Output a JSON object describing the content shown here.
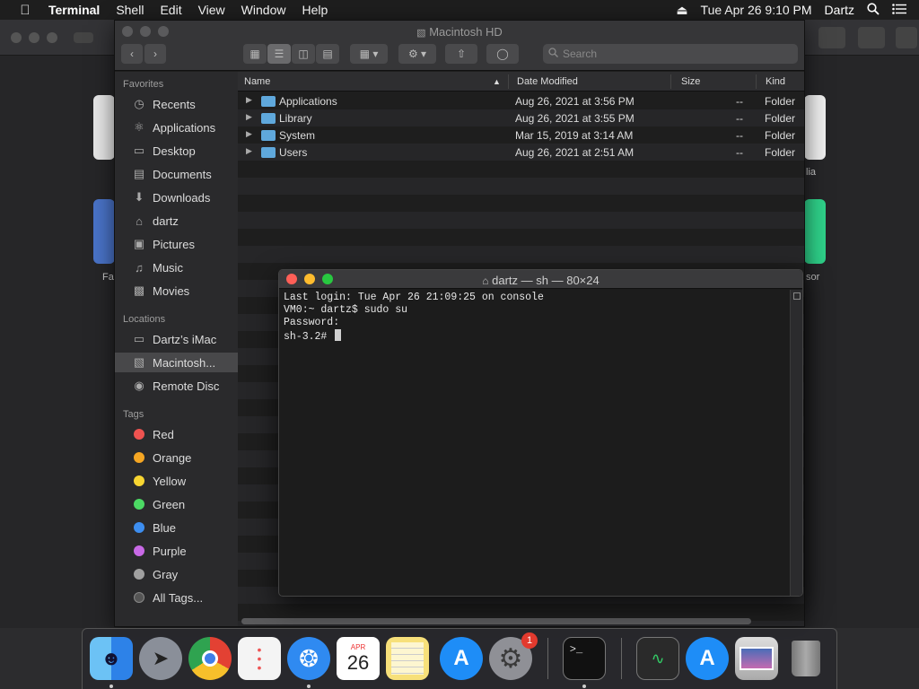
{
  "menubar": {
    "app": "Terminal",
    "items": [
      "Shell",
      "Edit",
      "View",
      "Window",
      "Help"
    ],
    "clock": "Tue Apr 26  9:10 PM",
    "user": "Dartz"
  },
  "background_window": {
    "labels": [
      "lia",
      "Fa",
      "sor"
    ]
  },
  "finder": {
    "title": "Macintosh HD",
    "search_placeholder": "Search",
    "sidebar": {
      "favorites_label": "Favorites",
      "favorites": [
        {
          "label": "Recents",
          "icon": "recents-icon"
        },
        {
          "label": "Applications",
          "icon": "applications-icon"
        },
        {
          "label": "Desktop",
          "icon": "desktop-icon"
        },
        {
          "label": "Documents",
          "icon": "documents-icon"
        },
        {
          "label": "Downloads",
          "icon": "downloads-icon"
        },
        {
          "label": "dartz",
          "icon": "home-icon"
        },
        {
          "label": "Pictures",
          "icon": "pictures-icon"
        },
        {
          "label": "Music",
          "icon": "music-icon"
        },
        {
          "label": "Movies",
          "icon": "movies-icon"
        }
      ],
      "locations_label": "Locations",
      "locations": [
        {
          "label": "Dartz’s iMac",
          "icon": "imac-icon"
        },
        {
          "label": "Macintosh...",
          "icon": "disk-icon",
          "selected": true
        },
        {
          "label": "Remote Disc",
          "icon": "remote-disc-icon"
        }
      ],
      "tags_label": "Tags",
      "tags": [
        {
          "label": "Red",
          "color": "#ef5350"
        },
        {
          "label": "Orange",
          "color": "#f5a623"
        },
        {
          "label": "Yellow",
          "color": "#f7d531"
        },
        {
          "label": "Green",
          "color": "#4cd964"
        },
        {
          "label": "Blue",
          "color": "#3d8ef0"
        },
        {
          "label": "Purple",
          "color": "#c869e6"
        },
        {
          "label": "Gray",
          "color": "#a0a0a0"
        },
        {
          "label": "All Tags...",
          "color": "#555555"
        }
      ]
    },
    "columns": {
      "name": "Name",
      "date": "Date Modified",
      "size": "Size",
      "kind": "Kind"
    },
    "rows": [
      {
        "name": "Applications",
        "date": "Aug 26, 2021 at 3:56 PM",
        "size": "--",
        "kind": "Folder"
      },
      {
        "name": "Library",
        "date": "Aug 26, 2021 at 3:55 PM",
        "size": "--",
        "kind": "Folder"
      },
      {
        "name": "System",
        "date": "Mar 15, 2019 at 3:14 AM",
        "size": "--",
        "kind": "Folder"
      },
      {
        "name": "Users",
        "date": "Aug 26, 2021 at 2:51 AM",
        "size": "--",
        "kind": "Folder"
      }
    ]
  },
  "terminal": {
    "title": "dartz — sh — 80×24",
    "lines": [
      "Last login: Tue Apr 26 21:09:25 on console",
      "VM0:~ dartz$ sudo su",
      "Password:",
      "sh-3.2# "
    ]
  },
  "dock": {
    "calendar_month": "APR",
    "calendar_day": "26",
    "settings_badge": "1",
    "terminal_prompt": ">_"
  }
}
